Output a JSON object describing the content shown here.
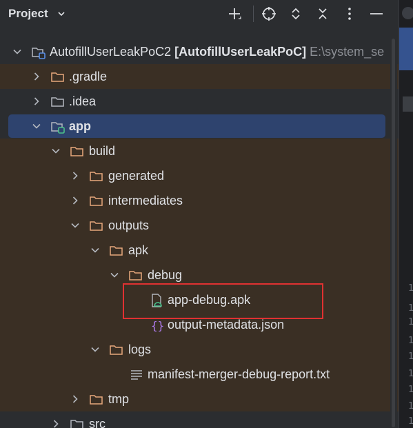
{
  "panel": {
    "title": "Project"
  },
  "toolbar": {
    "buttons": [
      {
        "name": "add-icon"
      },
      {
        "name": "locate-icon"
      },
      {
        "name": "expand-all-icon"
      },
      {
        "name": "collapse-all-icon"
      },
      {
        "name": "more-icon"
      },
      {
        "name": "minimize-icon"
      }
    ]
  },
  "tree": {
    "root": {
      "label": "AutofillUserLeakPoC2",
      "module": "[AutofillUserLeakPoC]",
      "path": "E:\\system_se"
    },
    "items": [
      {
        "label": ".gradle"
      },
      {
        "label": ".idea"
      },
      {
        "label": "app"
      },
      {
        "label": "build"
      },
      {
        "label": "generated"
      },
      {
        "label": "intermediates"
      },
      {
        "label": "outputs"
      },
      {
        "label": "apk"
      },
      {
        "label": "debug"
      },
      {
        "label": "app-debug.apk"
      },
      {
        "label": "output-metadata.json"
      },
      {
        "label": "logs"
      },
      {
        "label": "manifest-merger-debug-report.txt"
      },
      {
        "label": "tmp"
      },
      {
        "label": "src"
      }
    ]
  },
  "editor": {
    "line_digits": [
      "1",
      "1",
      "1",
      "1",
      "1",
      "1",
      "1",
      "1",
      "1"
    ]
  },
  "colors": {
    "selection": "#2e436e",
    "highlight_border": "#e03131",
    "build_band": "#3a2f24"
  }
}
